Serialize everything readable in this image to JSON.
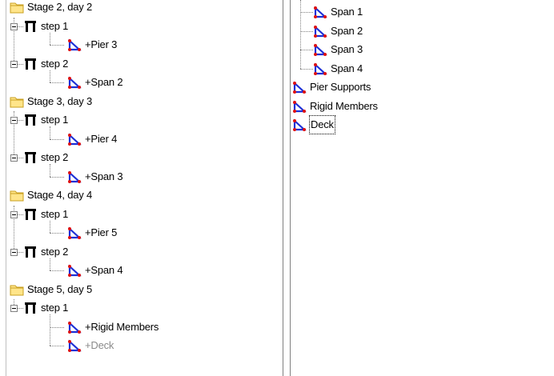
{
  "left_tree": {
    "stages": [
      {
        "label": "Stage 2, day 2",
        "steps": [
          {
            "label": "step 1",
            "children": [
              {
                "label": "+Pier 3",
                "grey": false
              }
            ]
          },
          {
            "label": "step 2",
            "children": [
              {
                "label": "+Span 2",
                "grey": false
              }
            ]
          }
        ]
      },
      {
        "label": "Stage 3, day 3",
        "steps": [
          {
            "label": "step 1",
            "children": [
              {
                "label": "+Pier 4",
                "grey": false
              }
            ]
          },
          {
            "label": "step 2",
            "children": [
              {
                "label": "+Span 3",
                "grey": false
              }
            ]
          }
        ]
      },
      {
        "label": "Stage 4, day 4",
        "steps": [
          {
            "label": "step 1",
            "children": [
              {
                "label": "+Pier 5",
                "grey": false
              }
            ]
          },
          {
            "label": "step 2",
            "children": [
              {
                "label": "+Span 4",
                "grey": false
              }
            ]
          }
        ]
      },
      {
        "label": "Stage 5, day 5",
        "steps": [
          {
            "label": "step 1",
            "children": [
              {
                "label": "+Rigid Members",
                "grey": false
              },
              {
                "label": "+Deck",
                "grey": true
              }
            ]
          }
        ]
      }
    ]
  },
  "right_tree": {
    "span_children": [
      {
        "label": "Span 1"
      },
      {
        "label": "Span 2"
      },
      {
        "label": "Span 3"
      },
      {
        "label": "Span 4"
      }
    ],
    "root_items": [
      {
        "label": "Pier Supports"
      },
      {
        "label": "Rigid Members"
      },
      {
        "label": "Deck",
        "focused": true
      }
    ]
  },
  "icons": {
    "folder": "folder-icon",
    "step": "step-icon",
    "member_group": "member-group-icon"
  },
  "colors": {
    "folder_fill": "#ffe58a",
    "folder_edge": "#c9a020",
    "member_blue": "#1c2fd6",
    "member_node_red": "#e01010",
    "grey_text": "#8a8a8a"
  }
}
